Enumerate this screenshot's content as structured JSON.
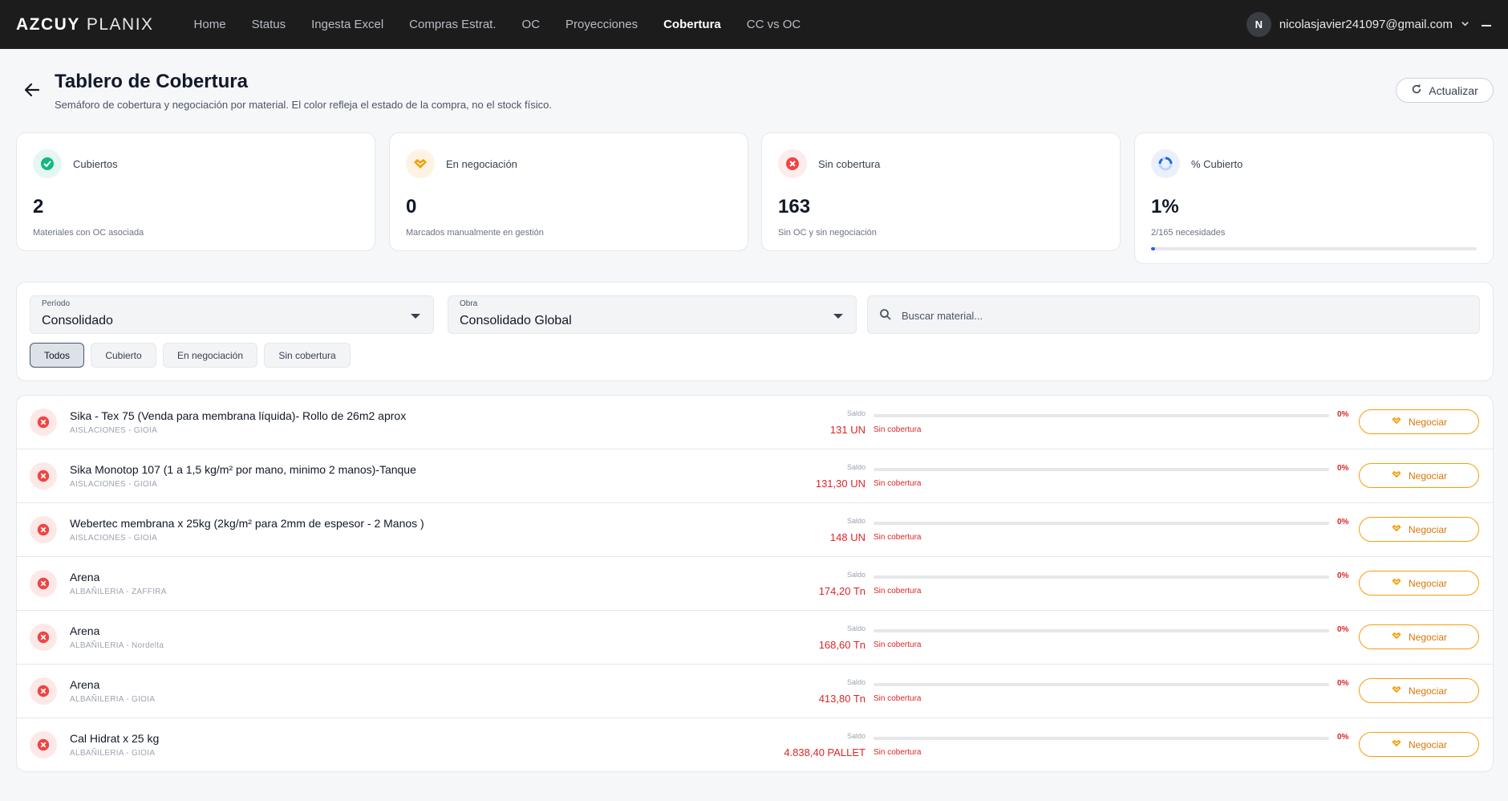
{
  "brand": {
    "bold": "AZCUY",
    "light": "PLANIX"
  },
  "nav": [
    "Home",
    "Status",
    "Ingesta Excel",
    "Compras Estrat.",
    "OC",
    "Proyecciones",
    "Cobertura",
    "CC vs OC"
  ],
  "nav_active": "Cobertura",
  "user": {
    "initial": "N",
    "email": "nicolasjavier241097@gmail.com"
  },
  "header": {
    "title": "Tablero de Cobertura",
    "subtitle": "Semáforo de cobertura y negociación por material. El color refleja el estado de la compra, no el stock físico.",
    "refresh_label": "Actualizar"
  },
  "kpis": [
    {
      "label": "Cubiertos",
      "value": "2",
      "desc": "Materiales con OC asociada",
      "color": "#10b981"
    },
    {
      "label": "En negociación",
      "value": "0",
      "desc": "Marcados manualmente en gestión",
      "color": "#f59e0b"
    },
    {
      "label": "Sin cobertura",
      "value": "163",
      "desc": "Sin OC y sin negociación",
      "color": "#ef4444"
    },
    {
      "label": "% Cubierto",
      "value": "1%",
      "desc": "2/165 necesidades",
      "color": "#2563eb",
      "progress_pct": 1.2
    }
  ],
  "filters": {
    "periodo": {
      "label": "Período",
      "value": "Consolidado"
    },
    "obra": {
      "label": "Obra",
      "value": "Consolidado Global"
    },
    "search_placeholder": "Buscar material...",
    "chips": [
      "Todos",
      "Cubierto",
      "En negociación",
      "Sin cobertura"
    ],
    "active_chip": "Todos"
  },
  "row_labels": {
    "saldo": "Saldo",
    "status": "Sin cobertura",
    "pct": "0%",
    "action": "Negociar"
  },
  "rows": [
    {
      "name": "Sika - Tex 75 (Venda para membrana líquida)- Rollo de 26m2 aprox",
      "category": "AISLACIONES - GIOIA",
      "saldo": "131 UN"
    },
    {
      "name": "Sika Monotop 107 (1 a 1,5 kg/m² por mano,  minimo 2 manos)-Tanque",
      "category": "AISLACIONES - GIOIA",
      "saldo": "131,30 UN"
    },
    {
      "name": "Webertec membrana x 25kg (2kg/m² para 2mm de espesor - 2 Manos )",
      "category": "AISLACIONES - GIOIA",
      "saldo": "148 UN"
    },
    {
      "name": "Arena",
      "category": "ALBAÑILERIA - ZAFFIRA",
      "saldo": "174,20 Tn"
    },
    {
      "name": "Arena",
      "category": "ALBAÑILERIA - Nordelta",
      "saldo": "168,60 Tn"
    },
    {
      "name": "Arena",
      "category": "ALBAÑILERIA - GIOIA",
      "saldo": "413,80 Tn"
    },
    {
      "name": "Cal Hidrat x 25 kg",
      "category": "ALBAÑILERIA - GIOIA",
      "saldo": "4.838,40 PALLET"
    }
  ]
}
